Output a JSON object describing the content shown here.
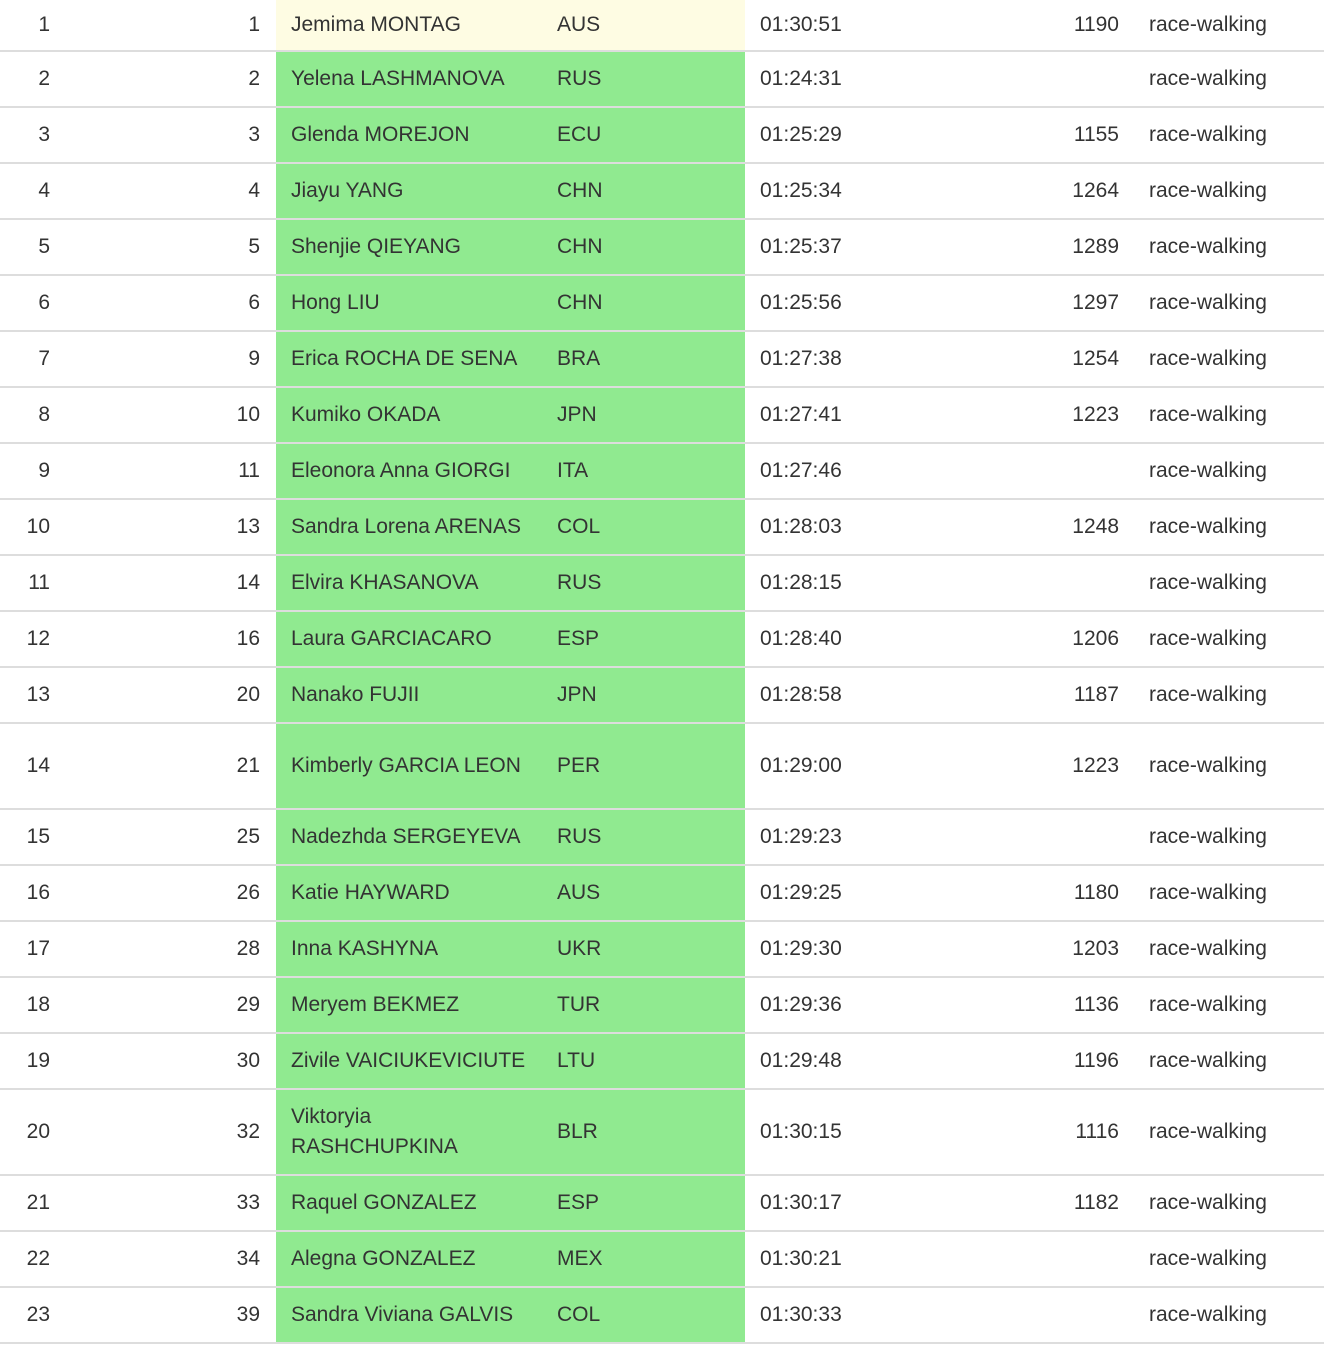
{
  "colors": {
    "highlight_green": "#90ea90",
    "highlight_yellow": "#fefce3",
    "row_border": "#dddddd"
  },
  "rows": [
    {
      "idx": "1",
      "rank": "1",
      "name": "Jemima MONTAG",
      "nat": "AUS",
      "time": "01:30:51",
      "points": "1190",
      "event": "race-walking",
      "highlight": "yellow"
    },
    {
      "idx": "2",
      "rank": "2",
      "name": "Yelena LASHMANOVA",
      "nat": "RUS",
      "time": "01:24:31",
      "points": "",
      "event": "race-walking",
      "highlight": "green"
    },
    {
      "idx": "3",
      "rank": "3",
      "name": "Glenda MOREJON",
      "nat": "ECU",
      "time": "01:25:29",
      "points": "1155",
      "event": "race-walking",
      "highlight": "green"
    },
    {
      "idx": "4",
      "rank": "4",
      "name": "Jiayu YANG",
      "nat": "CHN",
      "time": "01:25:34",
      "points": "1264",
      "event": "race-walking",
      "highlight": "green"
    },
    {
      "idx": "5",
      "rank": "5",
      "name": "Shenjie QIEYANG",
      "nat": "CHN",
      "time": "01:25:37",
      "points": "1289",
      "event": "race-walking",
      "highlight": "green"
    },
    {
      "idx": "6",
      "rank": "6",
      "name": "Hong LIU",
      "nat": "CHN",
      "time": "01:25:56",
      "points": "1297",
      "event": "race-walking",
      "highlight": "green"
    },
    {
      "idx": "7",
      "rank": "9",
      "name": "Erica ROCHA DE SENA",
      "nat": "BRA",
      "time": "01:27:38",
      "points": "1254",
      "event": "race-walking",
      "highlight": "green"
    },
    {
      "idx": "8",
      "rank": "10",
      "name": "Kumiko OKADA",
      "nat": "JPN",
      "time": "01:27:41",
      "points": "1223",
      "event": "race-walking",
      "highlight": "green"
    },
    {
      "idx": "9",
      "rank": "11",
      "name": "Eleonora Anna GIORGI",
      "nat": "ITA",
      "time": "01:27:46",
      "points": "",
      "event": "race-walking",
      "highlight": "green"
    },
    {
      "idx": "10",
      "rank": "13",
      "name": "Sandra Lorena ARENAS",
      "nat": "COL",
      "time": "01:28:03",
      "points": "1248",
      "event": "race-walking",
      "highlight": "green"
    },
    {
      "idx": "11",
      "rank": "14",
      "name": "Elvira KHASANOVA",
      "nat": "RUS",
      "time": "01:28:15",
      "points": "",
      "event": "race-walking",
      "highlight": "green"
    },
    {
      "idx": "12",
      "rank": "16",
      "name": "Laura GARCIACARO",
      "nat": "ESP",
      "time": "01:28:40",
      "points": "1206",
      "event": "race-walking",
      "highlight": "green"
    },
    {
      "idx": "13",
      "rank": "20",
      "name": "Nanako FUJII",
      "nat": "JPN",
      "time": "01:28:58",
      "points": "1187",
      "event": "race-walking",
      "highlight": "green"
    },
    {
      "idx": "14",
      "rank": "21",
      "name": "Kimberly GARCIA LEON",
      "nat": "PER",
      "time": "01:29:00",
      "points": "1223",
      "event": "race-walking",
      "highlight": "green"
    },
    {
      "idx": "15",
      "rank": "25",
      "name": "Nadezhda SERGEYEVA",
      "nat": "RUS",
      "time": "01:29:23",
      "points": "",
      "event": "race-walking",
      "highlight": "green"
    },
    {
      "idx": "16",
      "rank": "26",
      "name": "Katie HAYWARD",
      "nat": "AUS",
      "time": "01:29:25",
      "points": "1180",
      "event": "race-walking",
      "highlight": "green"
    },
    {
      "idx": "17",
      "rank": "28",
      "name": "Inna KASHYNA",
      "nat": "UKR",
      "time": "01:29:30",
      "points": "1203",
      "event": "race-walking",
      "highlight": "green"
    },
    {
      "idx": "18",
      "rank": "29",
      "name": "Meryem BEKMEZ",
      "nat": "TUR",
      "time": "01:29:36",
      "points": "1136",
      "event": "race-walking",
      "highlight": "green"
    },
    {
      "idx": "19",
      "rank": "30",
      "name": "Zivile VAICIUKEVICIUTE",
      "nat": "LTU",
      "time": "01:29:48",
      "points": "1196",
      "event": "race-walking",
      "highlight": "green"
    },
    {
      "idx": "20",
      "rank": "32",
      "name": "Viktoryia RASHCHUPKINA",
      "nat": "BLR",
      "time": "01:30:15",
      "points": "1116",
      "event": "race-walking",
      "highlight": "green"
    },
    {
      "idx": "21",
      "rank": "33",
      "name": "Raquel GONZALEZ",
      "nat": "ESP",
      "time": "01:30:17",
      "points": "1182",
      "event": "race-walking",
      "highlight": "green"
    },
    {
      "idx": "22",
      "rank": "34",
      "name": "Alegna GONZALEZ",
      "nat": "MEX",
      "time": "01:30:21",
      "points": "",
      "event": "race-walking",
      "highlight": "green"
    },
    {
      "idx": "23",
      "rank": "39",
      "name": "Sandra Viviana GALVIS",
      "nat": "COL",
      "time": "01:30:33",
      "points": "",
      "event": "race-walking",
      "highlight": "green"
    }
  ]
}
